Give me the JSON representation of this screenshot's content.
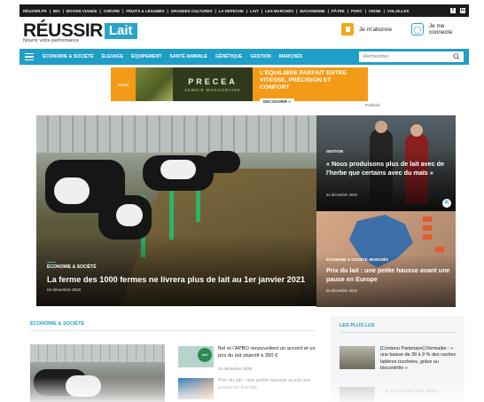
{
  "topbar": {
    "links": [
      "RÉUSSIR.FR",
      "BIO",
      "BOVINS VIANDE",
      "CHÈVRE",
      "FRUITS & LÉGUMES",
      "GRANDES CULTURES",
      "LA DEPECHE",
      "LAIT",
      "LES MARCHÉS",
      "MACHINISME",
      "PÂTRE",
      "PORC",
      "VIGNE",
      "VOLAILLES"
    ],
    "social": [
      "f",
      "in"
    ]
  },
  "header": {
    "logo_word": "RÉUSSIR",
    "logo_badge": "Lait",
    "tagline": "Nourrir votre performance",
    "subscribe": "Je m'abonne",
    "login": "Je me connecte"
  },
  "nav": {
    "items": [
      "ÉCONOMIE & SOCIÉTÉ",
      "ÉLEVAGE",
      "ÉQUIPEMENT",
      "SANTÉ ANIMALE",
      "GÉNÉTIQUE",
      "GESTION",
      "MARCHÉS"
    ],
    "search_placeholder": "Rechercher"
  },
  "ad": {
    "brand": "KUHN",
    "product": "PRECEA",
    "product_sub": "SEMOIR MONOGRAINE",
    "claim": "L'ÉQUILIBRE PARFAIT ENTRE VITESSE, PRÉCISION ET CONFORT",
    "cta": "DÉCOUVRIR >",
    "label": "Publicité"
  },
  "hero": {
    "tag": "ÉCONOMIE & SOCIÉTÉ",
    "title": "La ferme des 1000 fermes ne livrera plus de lait au 1er janvier 2021",
    "date": "04 décembre 2020"
  },
  "card1": {
    "tag": "GESTION",
    "title": "« Nous produisons plus de lait avec de l'herbe que certains avec du maïs »",
    "date": "04 décembre 2020",
    "badge": "R"
  },
  "card2": {
    "tag": "ÉCONOMIE & SOCIÉTÉ, MARCHÉS",
    "title": "Prix du lait : une petite hausse avant une pause en Europe",
    "date": "03 décembre 2020"
  },
  "section_eco": {
    "title": "ÉCONOMIE & SOCIÉTÉ",
    "news": [
      {
        "text": "Bel et l'APBO renouvellent un accord et un prix du lait objectif à 350 €",
        "date": "03 décembre 2020",
        "badge": "bel"
      },
      {
        "text": "Prix du lait : une petite hausse avant une pause en Europe",
        "date": ""
      }
    ]
  },
  "plus_lus": {
    "title": "LES PLUS LUS",
    "items": [
      {
        "text": "[Contenu Partenaire] Dermatite : « une baisse de 39 à 9 % des vaches laitières touchées, grâce au biocontrôle »"
      },
      {
        "text": "« Je ne pouvais plus gérer... »"
      }
    ]
  }
}
